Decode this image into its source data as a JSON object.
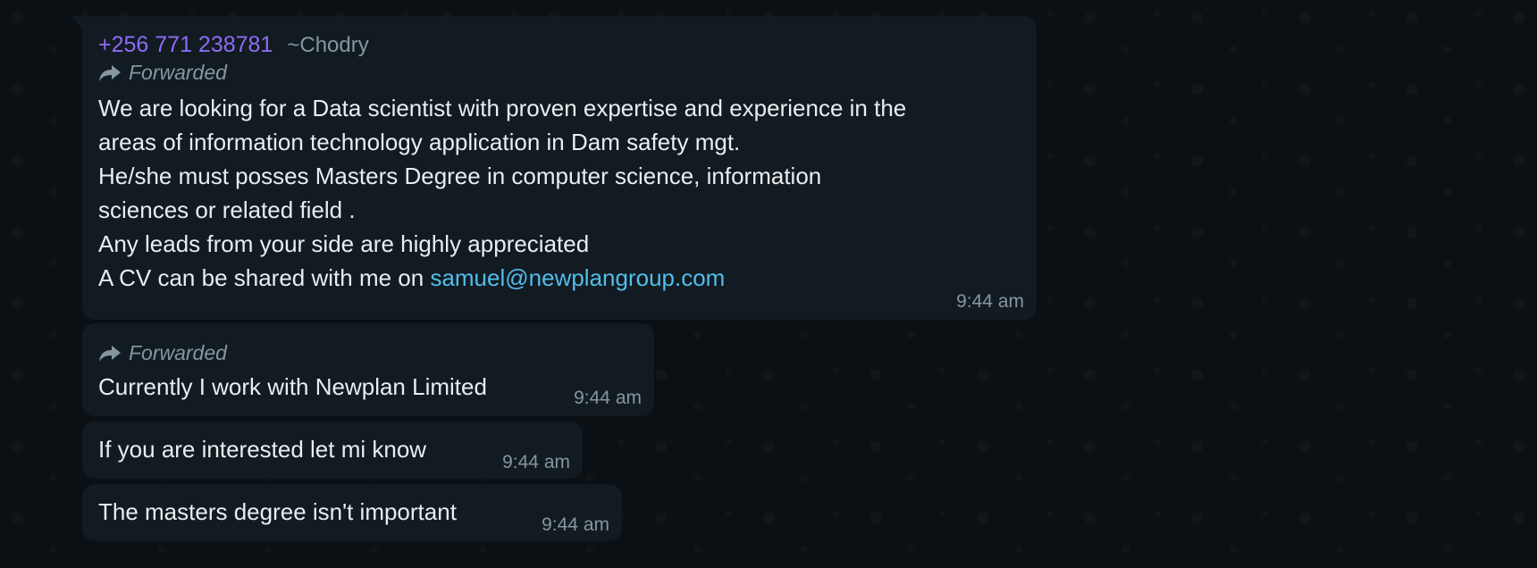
{
  "messages": [
    {
      "sender_phone": "+256 771 238781",
      "sender_name": "~Chodry",
      "forwarded_label": "Forwarded",
      "lines": [
        "We are looking for a Data scientist with proven expertise and experience in the",
        "areas of information technology application in Dam safety mgt.",
        "He/she must posses Masters Degree in computer science, information",
        "sciences or related field .",
        "Any leads from your side are highly appreciated"
      ],
      "last_line_prefix": "A CV can be shared with me on ",
      "email": "samuel@newplangroup.com",
      "time": "9:44 am"
    },
    {
      "forwarded_label": "Forwarded",
      "text": "Currently I work with Newplan Limited",
      "time": "9:44 am"
    },
    {
      "text": "If you are interested let mi know",
      "time": "9:44 am"
    },
    {
      "text": "The masters degree isn't important",
      "time": "9:44 am"
    }
  ],
  "colors": {
    "background": "#0b1014",
    "bubble": "#111b21",
    "sender_phone": "#8e6cf5",
    "secondary_text": "#8696a0",
    "link": "#53bdeb"
  },
  "icons": {
    "forward": "forward-arrow-icon"
  }
}
